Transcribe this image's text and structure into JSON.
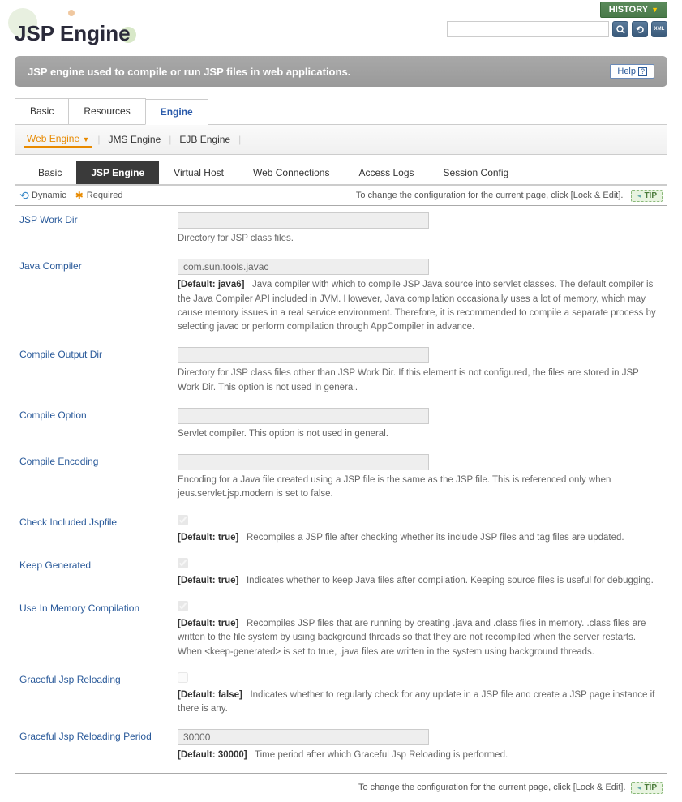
{
  "top": {
    "history": "HISTORY"
  },
  "page": {
    "title": "JSP Engine"
  },
  "description": "JSP engine used to compile or run JSP files in web applications.",
  "help": "Help",
  "tabs_l1": [
    "Basic",
    "Resources",
    "Engine"
  ],
  "tabs_l2": [
    "Web Engine",
    "JMS Engine",
    "EJB Engine"
  ],
  "tabs_l3": [
    "Basic",
    "JSP Engine",
    "Virtual Host",
    "Web Connections",
    "Access Logs",
    "Session Config"
  ],
  "legend": {
    "dynamic": "Dynamic",
    "required": "Required"
  },
  "tip_msg": "To change the configuration for the current page, click [Lock & Edit].",
  "tip_label": "TIP",
  "fields": {
    "jsp_work_dir": {
      "label": "JSP Work Dir",
      "value": "",
      "desc": "Directory for JSP class files."
    },
    "java_compiler": {
      "label": "Java Compiler",
      "value": "com.sun.tools.javac",
      "default": "[Default: java6]",
      "desc": "Java compiler with which to compile JSP Java source into servlet classes. The default compiler is the Java Compiler API included in JVM. However, Java compilation occasionally uses a lot of memory, which may cause memory issues in a real service environment. Therefore, it is recommended to compile a separate process by selecting javac or perform compilation through AppCompiler in advance."
    },
    "compile_output_dir": {
      "label": "Compile Output Dir",
      "value": "",
      "desc": "Directory for JSP class files other than JSP Work Dir. If this element is not configured, the files are stored in JSP Work Dir. This option is not used in general."
    },
    "compile_option": {
      "label": "Compile Option",
      "value": "",
      "desc": "Servlet compiler. This option is not used in general."
    },
    "compile_encoding": {
      "label": "Compile Encoding",
      "value": "",
      "desc": "Encoding for a Java file created using a JSP file is the same as the JSP file. This is referenced only when jeus.servlet.jsp.modern is set to false."
    },
    "check_included": {
      "label": "Check Included Jspfile",
      "default": "[Default: true]",
      "desc": "Recompiles a JSP file after checking whether its include JSP files and tag files are updated."
    },
    "keep_generated": {
      "label": "Keep Generated",
      "default": "[Default: true]",
      "desc": "Indicates whether to keep Java files after compilation. Keeping source files is useful for debugging."
    },
    "in_memory": {
      "label": "Use In Memory Compilation",
      "default": "[Default: true]",
      "desc": "Recompiles JSP files that are running by creating .java and .class files in memory. .class files are written to the file system by using background threads so that they are not recompiled when the server restarts. When <keep-generated> is set to true, .java files are written in the system using background threads."
    },
    "graceful": {
      "label": "Graceful Jsp Reloading",
      "default": "[Default: false]",
      "desc": "Indicates whether to regularly check for any update in a JSP file and create a JSP page instance if there is any."
    },
    "graceful_period": {
      "label": "Graceful Jsp Reloading Period",
      "value": "30000",
      "default": "[Default: 30000]",
      "desc": "Time period after which Graceful Jsp Reloading is performed."
    }
  }
}
